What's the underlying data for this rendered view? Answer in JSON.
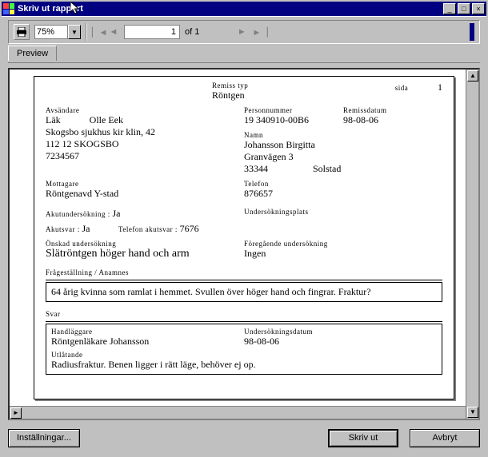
{
  "window": {
    "title": "Skriv ut rapport",
    "min": "_",
    "max": "□",
    "close": "×"
  },
  "toolbar": {
    "zoom_value": "75%",
    "page_current": "1",
    "of_label": "of",
    "page_total": "1"
  },
  "tabs": {
    "preview": "Preview"
  },
  "report": {
    "remisstyp_label": "Remiss typ",
    "remisstyp_value": "Röntgen",
    "sida_label": "sida",
    "sida_value": "1",
    "avsandare_label": "Avsändare",
    "lak_label": "Läk",
    "lak_value": "Olle Eek",
    "avs_line2": "Skogsbo sjukhus kir klin, 42",
    "avs_line3": "112 12 SKOGSBO",
    "avs_line4": "7234567",
    "personnummer_label": "Personnummer",
    "personnummer_value": "19 340910-00B6",
    "remissdatum_label": "Remissdatum",
    "remissdatum_value": "98-08-06",
    "namn_label": "Namn",
    "namn_value": "Johansson Birgitta",
    "adr_line2": "Granvägen 3",
    "adr_zip": "33344",
    "adr_city": "Solstad",
    "mottagare_label": "Mottagare",
    "mottagare_value": "Röntgenavd Y-stad",
    "telefon_label": "Telefon",
    "telefon_value": "876657",
    "akutundersokning_label": "Akutundersökning :",
    "akutundersokning_value": "Ja",
    "akutsvar_label": "Akutsvar :",
    "akutsvar_value": "Ja",
    "telefon_akutsvar_label": "Telefon akutsvar :",
    "telefon_akutsvar_value": "7676",
    "undersokningsplats_label": "Undersökningsplats",
    "onskad_lbl": "Önskad undersökning",
    "onskad_val": "Slätröntgen höger hand och arm",
    "foregaende_lbl": "Föregående undersökning",
    "foregaende_val": "Ingen",
    "fragestallning_lbl": "Frågeställning / Anamnes",
    "fragestallning_val": "64 årig kvinna som ramlat i hemmet. Svullen över höger hand och fingrar. Fraktur?",
    "svar_lbl": "Svar",
    "handlaggare_lbl": "Handläggare",
    "handlaggare_val": "Röntgenläkare Johansson",
    "undersokningsdatum_lbl": "Undersökningsdatum",
    "undersokningsdatum_val": "98-08-06",
    "utlatande_lbl": "Utlåtande",
    "utlatande_val": "Radiusfraktur. Benen ligger i rätt läge, behöver ej op."
  },
  "buttons": {
    "settings": "Inställningar...",
    "print": "Skriv ut",
    "cancel": "Avbryt"
  }
}
